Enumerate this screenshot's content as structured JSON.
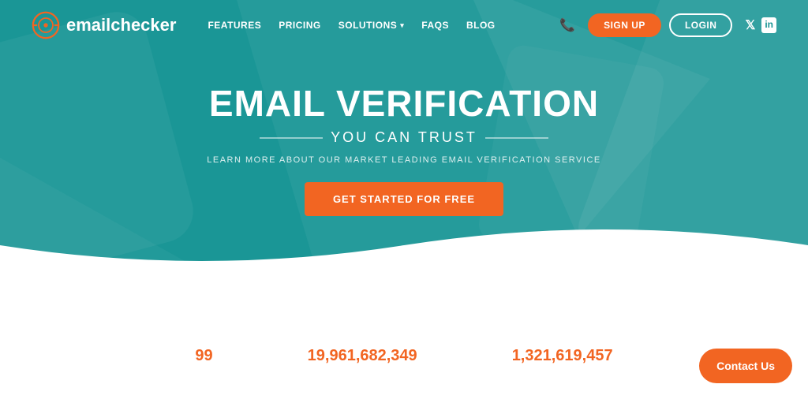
{
  "navbar": {
    "logo_text_plain": "email",
    "logo_text_bold": "checker",
    "nav_links": [
      {
        "label": "FEATURES",
        "has_dropdown": false
      },
      {
        "label": "PRICING",
        "has_dropdown": false
      },
      {
        "label": "SOLUTIONS",
        "has_dropdown": true
      },
      {
        "label": "FAQS",
        "has_dropdown": false
      },
      {
        "label": "BLOG",
        "has_dropdown": false
      }
    ],
    "signup_label": "SIGN UP",
    "login_label": "LOGIN"
  },
  "hero": {
    "title": "EMAIL VERIFICATION",
    "subtitle": "YOU CAN TRUST",
    "description": "LEARN MORE ABOUT OUR MARKET LEADING EMAIL VERIFICATION SERVICE",
    "cta_label": "GET STARTED FOR FREE"
  },
  "stats": [
    {
      "icon": "paper-plane-icon",
      "value": "99"
    },
    {
      "icon": "mail-icon",
      "value": "19,961,682,349"
    },
    {
      "icon": "trash-icon",
      "value": "1,321,619,457"
    }
  ],
  "contact_us": {
    "label": "Contact Us"
  },
  "colors": {
    "teal": "#1a9696",
    "orange": "#f26522",
    "white": "#ffffff"
  }
}
